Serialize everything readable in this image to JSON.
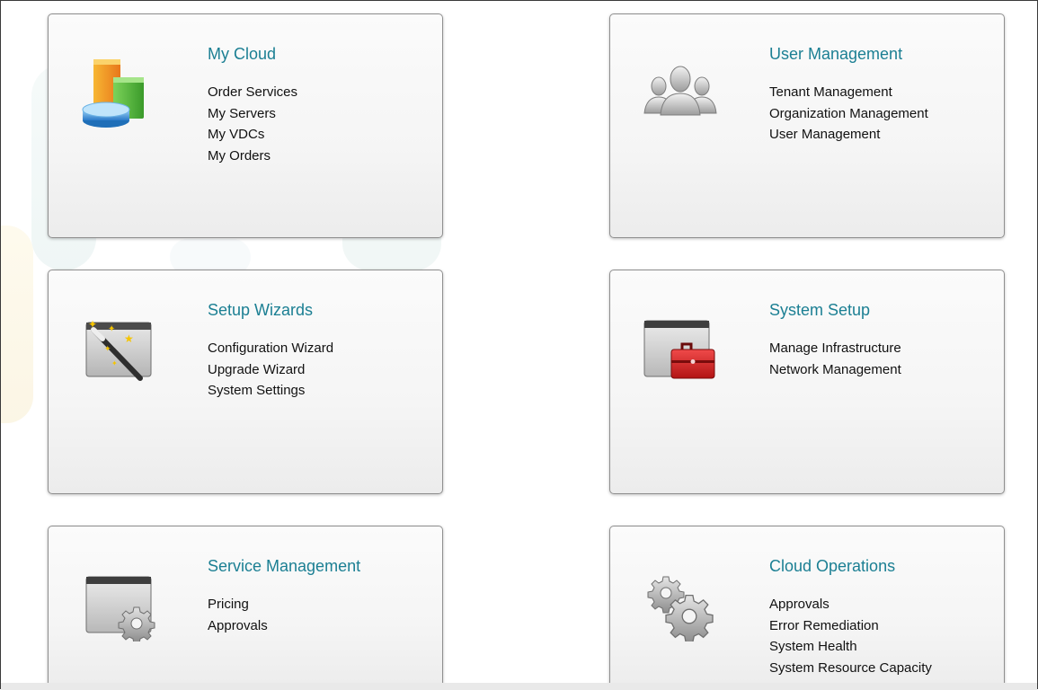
{
  "cards": [
    {
      "title": "My Cloud",
      "icon": "storage-blocks-icon",
      "links": [
        "Order Services",
        "My Servers",
        "My VDCs",
        "My Orders"
      ]
    },
    {
      "title": "User Management",
      "icon": "users-group-icon",
      "links": [
        "Tenant Management",
        "Organization Management",
        "User Management"
      ]
    },
    {
      "title": "Setup Wizards",
      "icon": "wizard-wand-icon",
      "links": [
        "Configuration Wizard",
        "Upgrade Wizard",
        "System Settings"
      ]
    },
    {
      "title": "System Setup",
      "icon": "toolbox-window-icon",
      "links": [
        "Manage Infrastructure",
        "Network Management"
      ]
    },
    {
      "title": "Service Management",
      "icon": "gear-window-icon",
      "links": [
        "Pricing",
        "Approvals"
      ]
    },
    {
      "title": "Cloud Operations",
      "icon": "gears-icon",
      "links": [
        "Approvals",
        "Error Remediation",
        "System Health",
        "System Resource Capacity"
      ]
    }
  ],
  "colors": {
    "title": "#1b7f93",
    "link": "#111111",
    "card_border": "#8f8f8f"
  }
}
